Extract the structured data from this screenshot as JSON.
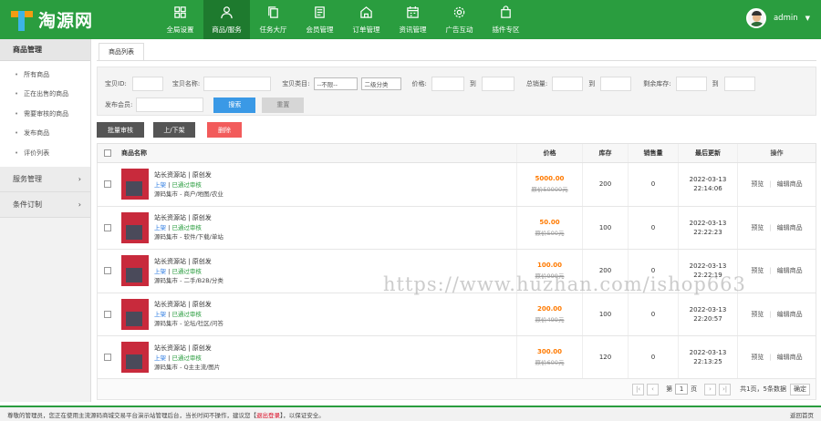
{
  "brand": {
    "name": "淘源网"
  },
  "nav": [
    {
      "label": "全局设置",
      "icon": "grid-icon"
    },
    {
      "label": "商品/服务",
      "icon": "user-icon",
      "active": true
    },
    {
      "label": "任务大厅",
      "icon": "copy-icon"
    },
    {
      "label": "会员管理",
      "icon": "list-icon"
    },
    {
      "label": "订单管理",
      "icon": "home-icon"
    },
    {
      "label": "资讯管理",
      "icon": "calendar-icon"
    },
    {
      "label": "广告互动",
      "icon": "gear-icon"
    },
    {
      "label": "插件专区",
      "icon": "bag-icon"
    }
  ],
  "user": {
    "name": "admin"
  },
  "sidebar": {
    "head": "商品管理",
    "items": [
      "所有商品",
      "正在出售的商品",
      "需要审核的商品",
      "发布商品",
      "评价列表"
    ],
    "groups": [
      "服务管理",
      "条件订制"
    ]
  },
  "tabs": [
    "商品列表"
  ],
  "filter": {
    "id_label": "宝贝ID:",
    "name_label": "宝贝名称:",
    "type_label": "宝贝类目:",
    "type_value": "--不限--",
    "subtype_value": "二级分类",
    "price_label": "价格:",
    "to": "到",
    "sales_label": "总销量:",
    "stock_label": "剩余库存:",
    "seller_label": "发布会员:",
    "search_btn": "搜索",
    "reset_btn": "重置"
  },
  "actions": {
    "audit": "批量审核",
    "shelf": "上/下架",
    "delete": "删除"
  },
  "table": {
    "headers": [
      "商品名称",
      "价格",
      "库存",
      "销售量",
      "最后更新",
      "操作"
    ],
    "rows": [
      {
        "title": "站长资源站 | 原创发",
        "status1": "上架",
        "status2": "已通过审核",
        "cat": "源码集市 - 商户/地图/农业",
        "price": "5000.00",
        "oprice": "原价50000元",
        "stock": "200",
        "sales": "0",
        "date": "2022-03-13",
        "time": "22:14:06",
        "op1": "预览",
        "op2": "编辑商品"
      },
      {
        "title": "站长资源站 | 原创发",
        "status1": "上架",
        "status2": "已通过审核",
        "cat": "源码集市 - 软件/下载/单站",
        "price": "50.00",
        "oprice": "原价500元",
        "stock": "100",
        "sales": "0",
        "date": "2022-03-13",
        "time": "22:22:23",
        "op1": "预览",
        "op2": "编辑商品"
      },
      {
        "title": "站长资源站 | 原创发",
        "status1": "上架",
        "status2": "已通过审核",
        "cat": "源码集市 - 二手/B2B/分类",
        "price": "100.00",
        "oprice": "原价999元",
        "stock": "200",
        "sales": "0",
        "date": "2022-03-13",
        "time": "22:22:19",
        "op1": "预览",
        "op2": "编辑商品"
      },
      {
        "title": "站长资源站 | 原创发",
        "status1": "上架",
        "status2": "已通过审核",
        "cat": "源码集市 - 论坛/社区/问答",
        "price": "200.00",
        "oprice": "原价499元",
        "stock": "100",
        "sales": "0",
        "date": "2022-03-13",
        "time": "22:20:57",
        "op1": "预览",
        "op2": "编辑商品"
      },
      {
        "title": "站长资源站 | 原创发",
        "status1": "上架",
        "status2": "已通过审核",
        "cat": "源码集市 - Q主主流/图片",
        "price": "300.00",
        "oprice": "原价600元",
        "stock": "120",
        "sales": "0",
        "date": "2022-03-13",
        "time": "22:13:25",
        "op1": "预览",
        "op2": "编辑商品"
      }
    ]
  },
  "pager": {
    "page_prefix": "第",
    "page_value": "1",
    "page_suffix": "页",
    "summary": "共1页，5条数据",
    "confirm": "确定"
  },
  "footer": {
    "text": "尊敬的管理员，您正在使用主流源码商城交易平台演示站管理后台，当长时间不操作，建议您【",
    "logout": "退出登录",
    "text2": "】，以保证安全。",
    "right": "返回首页"
  },
  "watermark": "https://www.huzhan.com/ishop663",
  "colors": {
    "brand": "#2a9d3f",
    "price": "#ff7a00",
    "danger": "#f25b5b",
    "primary_btn": "#3a99e6"
  }
}
